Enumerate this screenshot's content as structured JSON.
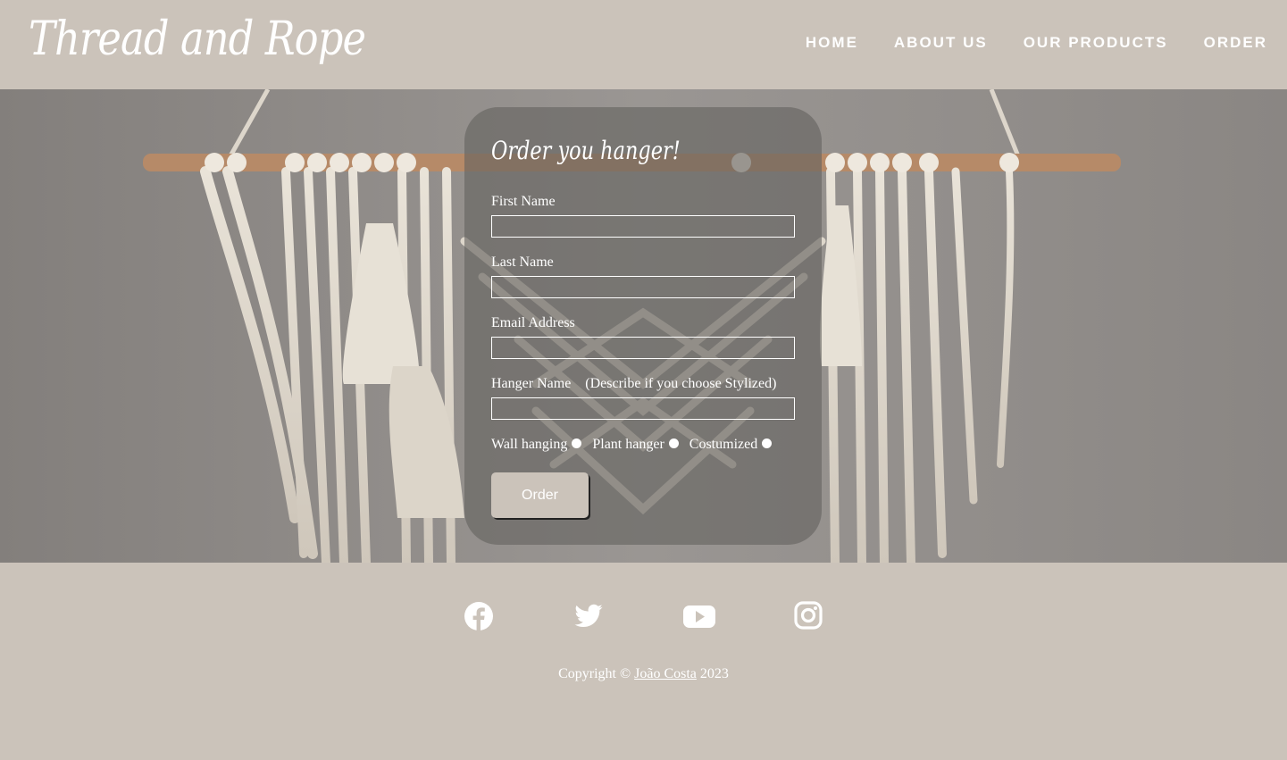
{
  "header": {
    "logo": "Thread and Rope",
    "nav": [
      "HOME",
      "ABOUT US",
      "OUR PRODUCTS",
      "ORDER"
    ]
  },
  "form": {
    "title": "Order you hanger!",
    "fields": [
      {
        "label": "First Name",
        "value": ""
      },
      {
        "label": "Last Name",
        "value": ""
      },
      {
        "label": "Email Address",
        "value": ""
      },
      {
        "label": "Hanger Name    (Describe if you choose Stylized)",
        "value": ""
      }
    ],
    "radios": [
      "Wall hanging",
      "Plant hanger",
      "Costumized"
    ],
    "submit_label": "Order"
  },
  "footer": {
    "social_icons": [
      "facebook-icon",
      "twitter-icon",
      "youtube-icon",
      "instagram-icon"
    ],
    "copyright_prefix": "Copyright ©",
    "author": "João Costa",
    "year": "2023"
  },
  "colors": {
    "background": "#cbc3ba",
    "text": "#ffffff",
    "card": "#646260"
  }
}
